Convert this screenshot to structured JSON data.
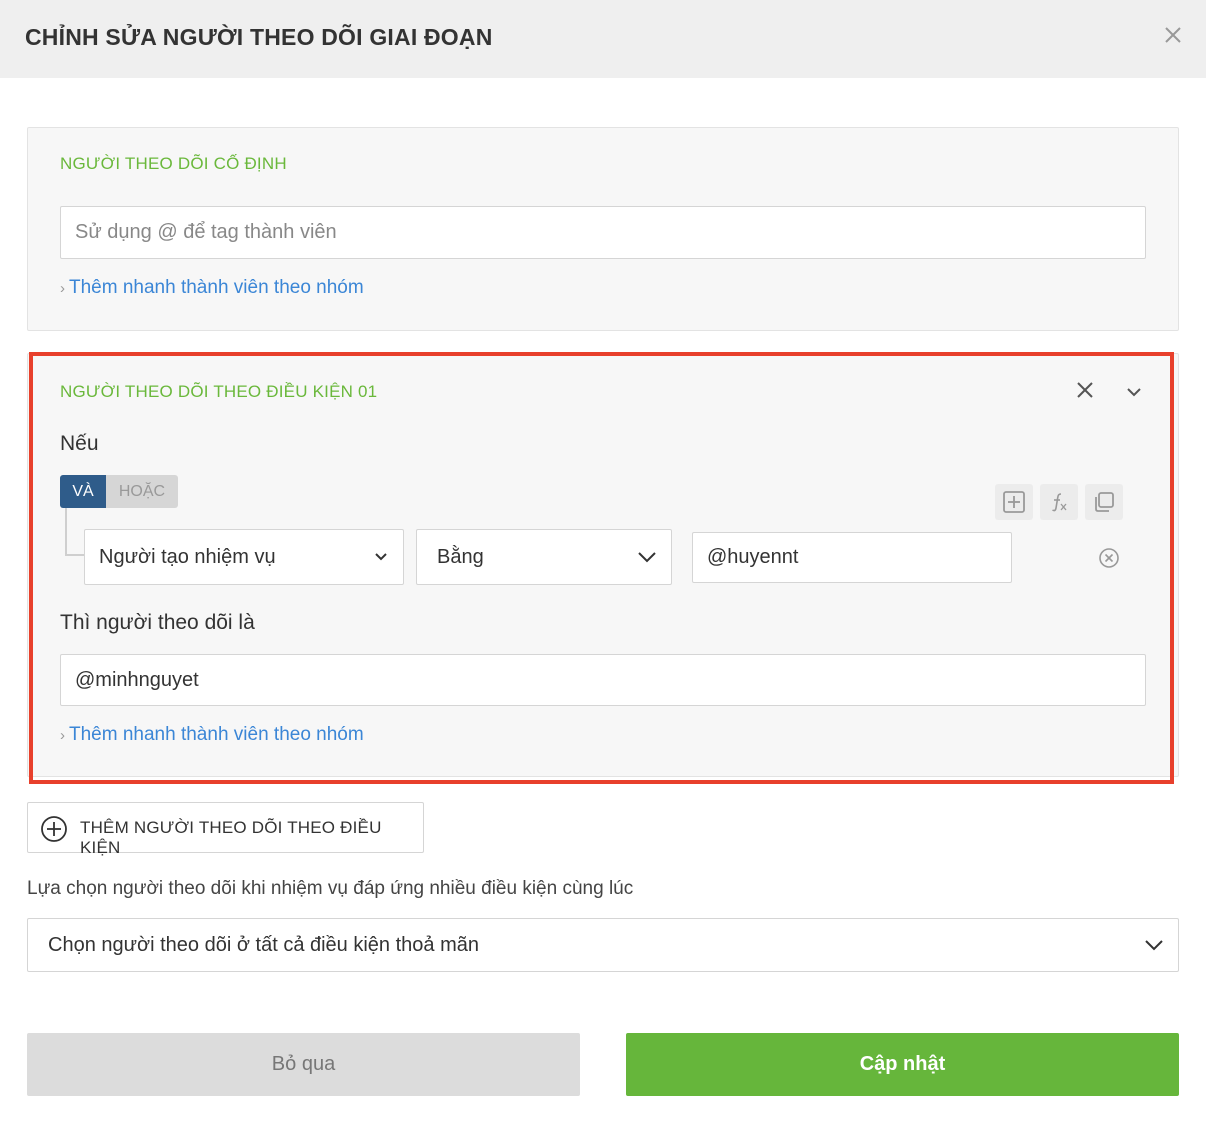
{
  "dialog": {
    "title": "CHỈNH SỬA NGƯỜI THEO DÕI GIAI ĐOẠN",
    "close_icon": "close-icon"
  },
  "fixed_followers": {
    "title": "NGƯỜI THEO DÕI CỐ ĐỊNH",
    "input_placeholder": "Sử dụng @ để tag thành viên",
    "input_value": "",
    "quick_add_link": "Thêm nhanh thành viên theo nhóm"
  },
  "conditional_followers": {
    "title": "NGƯỜI THEO DÕI THEO ĐIỀU KIỆN 01",
    "if_label": "Nếu",
    "logic_toggle": {
      "and_label": "VÀ",
      "or_label": "HOẶC",
      "selected": "VÀ"
    },
    "tool_icons": [
      "add-condition-icon",
      "formula-icon",
      "duplicate-icon"
    ],
    "condition": {
      "field": "Người tạo nhiệm vụ",
      "operator": "Bằng",
      "value": "@huyennt"
    },
    "then_label": "Thì người theo dõi là",
    "followers_value": "@minhnguyet",
    "quick_add_link": "Thêm nhanh thành viên theo nhóm"
  },
  "add_condition_button": "THÊM NGƯỜI THEO DÕI THEO ĐIỀU KIỆN",
  "multi_condition": {
    "label": "Lựa chọn người theo dõi khi nhiệm vụ đáp ứng nhiều điều kiện cùng lúc",
    "selected": "Chọn người theo dõi ở tất cả điều kiện thoả mãn"
  },
  "footer": {
    "cancel_label": "Bỏ qua",
    "update_label": "Cập nhật"
  },
  "colors": {
    "accent_green": "#6ab83b",
    "link_blue": "#3b86d6",
    "toggle_active": "#2f5c8a",
    "highlight_red": "#e8402c"
  }
}
